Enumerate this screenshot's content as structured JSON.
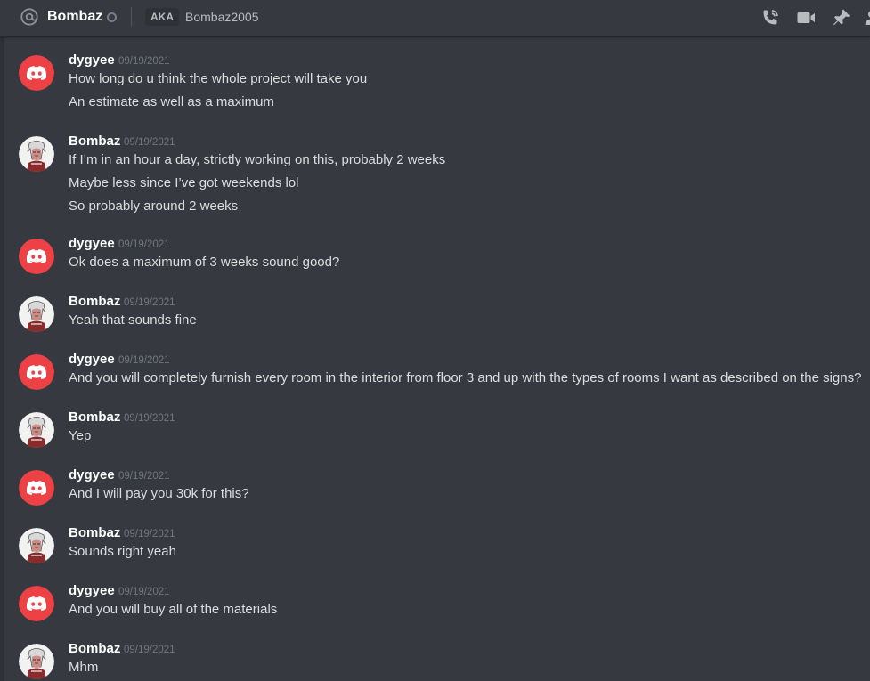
{
  "header": {
    "channel_name": "Bombaz",
    "aka_label": "AKA",
    "aka_name": "Bombaz2005",
    "icons": [
      "at-icon",
      "voice-call-icon",
      "video-call-icon",
      "pin-icon",
      "add-friend-icon"
    ]
  },
  "colors": {
    "background": "#36393f",
    "discord_red": "#ed4245",
    "username": "#ffffff",
    "message_text": "#dcddde",
    "timestamp": "#72767d"
  },
  "messages": [
    {
      "author": "dygyee",
      "timestamp": "09/19/2021",
      "lines": [
        "How long do u think the whole project will take you",
        "An estimate as well as a maximum"
      ]
    },
    {
      "author": "Bombaz",
      "timestamp": "09/19/2021",
      "lines": [
        "If I’m in an hour a day, strictly working on this, probably 2 weeks",
        "Maybe less since I’ve got weekends lol",
        "So probably around 2 weeks"
      ]
    },
    {
      "author": "dygyee",
      "timestamp": "09/19/2021",
      "lines": [
        "Ok does a maximum of 3 weeks sound good?"
      ]
    },
    {
      "author": "Bombaz",
      "timestamp": "09/19/2021",
      "lines": [
        "Yeah that sounds fine"
      ]
    },
    {
      "author": "dygyee",
      "timestamp": "09/19/2021",
      "lines": [
        "And you will completely furnish every room in the interior from floor 3 and up with the types of rooms I want as described on the signs?"
      ]
    },
    {
      "author": "Bombaz",
      "timestamp": "09/19/2021",
      "lines": [
        "Yep"
      ]
    },
    {
      "author": "dygyee",
      "timestamp": "09/19/2021",
      "lines": [
        "And I will pay you 30k for this?"
      ]
    },
    {
      "author": "Bombaz",
      "timestamp": "09/19/2021",
      "lines": [
        "Sounds right yeah"
      ]
    },
    {
      "author": "dygyee",
      "timestamp": "09/19/2021",
      "lines": [
        "And you will buy all of the materials"
      ]
    },
    {
      "author": "Bombaz",
      "timestamp": "09/19/2021",
      "lines": [
        "Mhm"
      ]
    }
  ]
}
